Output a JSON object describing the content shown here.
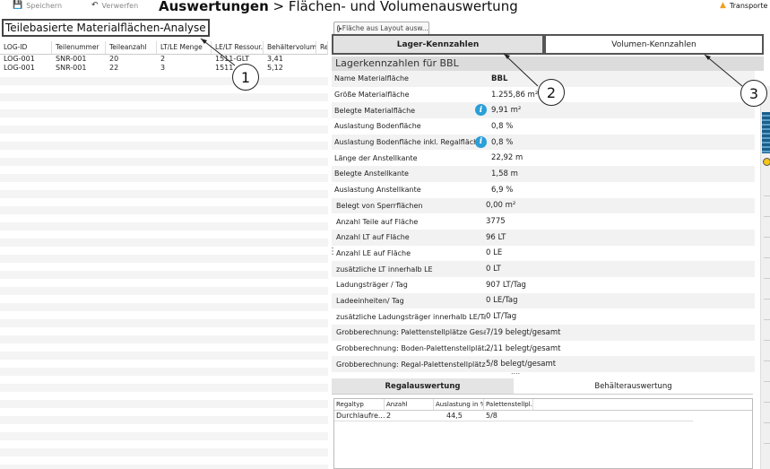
{
  "toolbar": {
    "save_label": "Speichern",
    "revert_label": "Verwerfen",
    "title_bold": "Auswertungen",
    "title_rest": " > Flächen- und Volumenauswertung",
    "transport_label": "Transporte n"
  },
  "left": {
    "title": "Teilebasierte Materialflächen-Analyse",
    "columns": [
      "LOG-ID",
      "Teilenummer",
      "Teileanzahl",
      "LT/LE Menge",
      "LE/LT Ressour...",
      "Behältervolum...",
      "Re"
    ],
    "rows": [
      [
        "LOG-001",
        "SNR-001",
        "20",
        "2",
        "1511-GLT",
        "3,41",
        ""
      ],
      [
        "LOG-001",
        "SNR-001",
        "22",
        "3",
        "1511",
        "5,12",
        ""
      ]
    ]
  },
  "right": {
    "layout_button": "Fläche aus Layout ausw...",
    "tab_lager": "Lager-Kennzahlen",
    "tab_volumen": "Volumen-Kennzahlen",
    "header": "Lagerkennzahlen für BBL",
    "kennzahlen": [
      {
        "label": "Name Materialfläche",
        "value": "BBL"
      },
      {
        "label": "Größe Materialfläche",
        "value": "1.255,86 m²"
      },
      {
        "label": "Belegte Materialfläche",
        "value": "9,91 m²"
      },
      {
        "label": "Auslastung Bodenfläche",
        "value": "0,8 %"
      },
      {
        "label": "Auslastung Bodenfläche inkl. Regalfläche",
        "value": "0,8 %"
      },
      {
        "label": "Länge der Anstellkante",
        "value": "22,92 m"
      },
      {
        "label": "Belegte Anstellkante",
        "value": "1,58 m"
      },
      {
        "label": "Auslastung Anstellkante",
        "value": "6,9 %"
      },
      {
        "label": "Belegt von Sperrflächen",
        "value": "0,00 m²"
      },
      {
        "label": "Anzahl Teile auf Fläche",
        "value": "3775"
      },
      {
        "label": "Anzahl LT auf Fläche",
        "value": "96 LT"
      },
      {
        "label": "Anzahl LE auf Fläche",
        "value": "0 LE"
      },
      {
        "label": "zusätzliche LT innerhalb LE",
        "value": "0 LT"
      },
      {
        "label": "Ladungsträger / Tag",
        "value": "907 LT/Tag"
      },
      {
        "label": "Ladeeinheiten/ Tag",
        "value": "0 LE/Tag"
      },
      {
        "label": "zusätzliche Ladungsträger innerhalb LE/Tag",
        "value": "0 LT/Tag"
      },
      {
        "label": "Grobberechnung: Palettenstellplätze Gesamt",
        "value": "7/19 belegt/gesamt"
      },
      {
        "label": "Grobberechnung: Boden-Palettenstellplätze",
        "value": "2/11 belegt/gesamt"
      },
      {
        "label": "Grobberechnung: Regal-Palettenstellplätze",
        "value": "5/8 belegt/gesamt"
      }
    ],
    "more_dots": "....",
    "sub_tab_regal": "Regalauswertung",
    "sub_tab_behaelter": "Behälterauswertung",
    "regal_columns": [
      "Regaltyp",
      "Anzahl",
      "Auslastung in %",
      "Palettenstellpl..."
    ],
    "regal_rows": [
      [
        "Durchlaufre...",
        "2",
        "44,5",
        "5/8"
      ]
    ]
  },
  "callouts": [
    "1",
    "2",
    "3"
  ],
  "icons": {
    "save": "save-icon",
    "revert": "undo-icon",
    "warning": "warning-icon",
    "info": "info-icon"
  },
  "colors": {
    "info_blue": "#2a9fd8",
    "warning_orange": "#f0a020",
    "tab_active_bg": "#e2e2e2"
  }
}
